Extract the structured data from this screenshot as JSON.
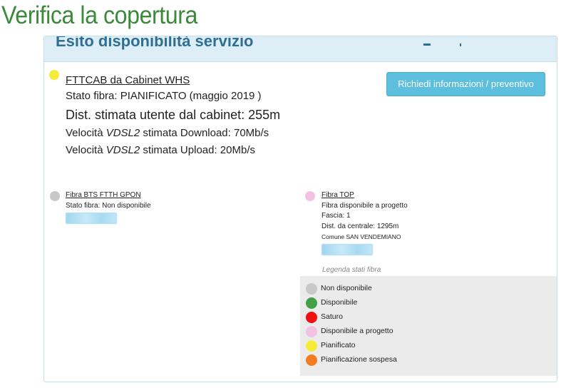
{
  "page": {
    "title": "Verifica la copertura"
  },
  "panel": {
    "header_title": "Esito disponibilità servizio"
  },
  "main_service": {
    "name": "FTTCAB da Cabinet WHS",
    "status": "Stato fibra: PIANIFICATO (maggio 2019 )",
    "distance": "Dist. stimata utente dal cabinet: 255m",
    "download_prefix": "Velocità ",
    "download_tech": "VDSL2",
    "download_suffix": " stimata Download: 70Mb/s",
    "upload_prefix": "Velocità ",
    "upload_tech": "VDSL2",
    "upload_suffix": " stimata Upload: 20Mb/s",
    "status_color": "#f5ec3a"
  },
  "cta": {
    "label": "Richiedi informazioni / preventivo"
  },
  "service_bts": {
    "name": "Fibra BTS FTTH GPON",
    "status": "Stato fibra: Non disponibile",
    "status_color": "#c8c8c8"
  },
  "service_top": {
    "name": "Fibra TOP",
    "status": "Fibra disponibile a progetto",
    "fascia": "Fascia: 1",
    "distance": "Dist. da centrale: 1295m",
    "comune": "Comune SAN VENDEMIANO",
    "status_color": "#f3c2e2"
  },
  "legend": {
    "title": "Legenda stati fibra",
    "items": [
      {
        "label": "Non disponibile",
        "color": "#c8c8c8"
      },
      {
        "label": "Disponibile",
        "color": "#43a047"
      },
      {
        "label": "Saturo",
        "color": "#ef1010"
      },
      {
        "label": "Disponibile a progetto",
        "color": "#f3c2e2"
      },
      {
        "label": "Pianificato",
        "color": "#f5ec3a"
      },
      {
        "label": "Pianificazione sospesa",
        "color": "#f47c20"
      }
    ]
  }
}
